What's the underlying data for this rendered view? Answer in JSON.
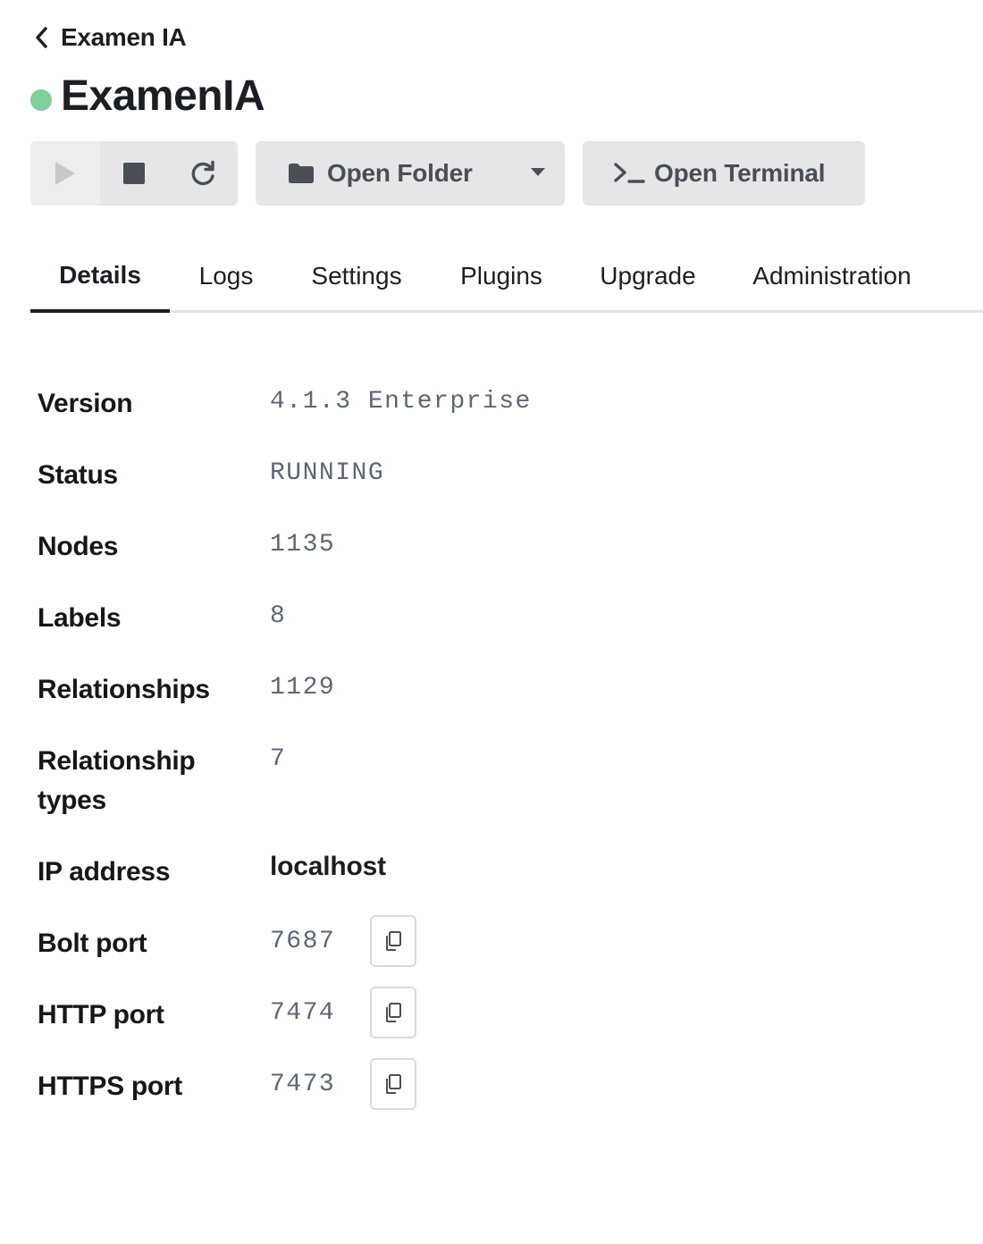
{
  "back": {
    "label": "Examen IA"
  },
  "header": {
    "title": "ExamenIA",
    "status_color": "#7fcf9b"
  },
  "toolbar": {
    "open_folder": "Open Folder",
    "open_terminal": "Open Terminal"
  },
  "tabs": [
    {
      "label": "Details",
      "active": true
    },
    {
      "label": "Logs",
      "active": false
    },
    {
      "label": "Settings",
      "active": false
    },
    {
      "label": "Plugins",
      "active": false
    },
    {
      "label": "Upgrade",
      "active": false
    },
    {
      "label": "Administration",
      "active": false
    }
  ],
  "details": {
    "version": {
      "label": "Version",
      "value": "4.1.3 Enterprise"
    },
    "status": {
      "label": "Status",
      "value": "RUNNING"
    },
    "nodes": {
      "label": "Nodes",
      "value": "1135"
    },
    "labels": {
      "label": "Labels",
      "value": "8"
    },
    "relationships": {
      "label": "Relationships",
      "value": "1129"
    },
    "relationship_types": {
      "label": "Relationship types",
      "value": "7"
    },
    "ip_address": {
      "label": "IP address",
      "value": "localhost"
    },
    "bolt_port": {
      "label": "Bolt port",
      "value": "7687"
    },
    "http_port": {
      "label": "HTTP port",
      "value": "7474"
    },
    "https_port": {
      "label": "HTTPS port",
      "value": "7473"
    }
  }
}
